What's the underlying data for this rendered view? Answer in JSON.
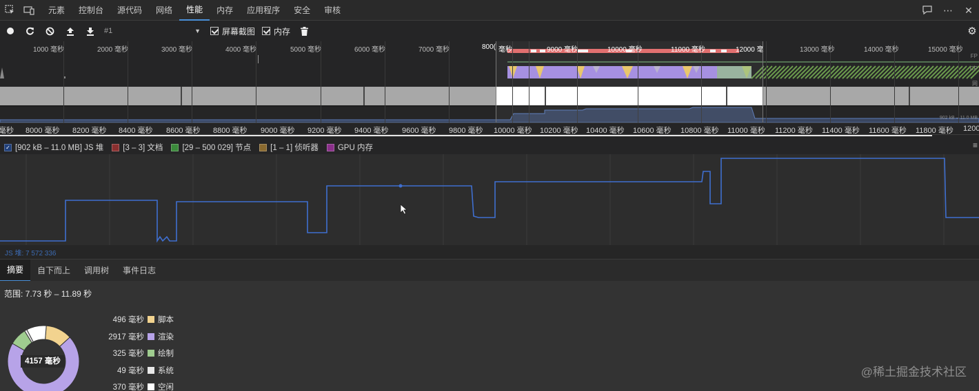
{
  "tabbar": {
    "tabs": [
      "元素",
      "控制台",
      "源代码",
      "网络",
      "性能",
      "内存",
      "应用程序",
      "安全",
      "审核"
    ],
    "active_index": 4
  },
  "toolbar": {
    "profile_label": "#1",
    "screenshots_label": "屏幕截图",
    "memory_label": "内存"
  },
  "overview": {
    "ticks": [
      "1000 毫秒",
      "2000 毫秒",
      "3000 毫秒",
      "4000 毫秒",
      "5000 毫秒",
      "6000 毫秒",
      "7000 毫秒",
      "800(",
      "毫秒",
      "9000 毫秒",
      "10000 毫秒",
      "11000 毫秒",
      "12000 毫",
      "13000 毫秒",
      "14000 毫秒",
      "15000 毫秒"
    ],
    "labels": [
      "FP",
      "CP",
      "网",
      "902 kB – 11.0 MB"
    ]
  },
  "ruler": {
    "ticks": [
      "毫秒",
      "8000 毫秒",
      "8200 毫秒",
      "8400 毫秒",
      "8600 毫秒",
      "8800 毫秒",
      "9000 毫秒",
      "9200 毫秒",
      "9400 毫秒",
      "9600 毫秒",
      "9800 毫秒",
      "10000 毫秒",
      "10200 毫秒",
      "10400 毫秒",
      "10600 毫秒",
      "10800 毫秒",
      "11000 毫秒",
      "11200 毫秒",
      "11400 毫秒",
      "11600 毫秒",
      "11800 毫秒",
      "1200"
    ]
  },
  "legend": {
    "items": [
      {
        "label": "[902 kB – 11.0 MB] JS 堆",
        "color": "#3f6fb5",
        "checked": true
      },
      {
        "label": "[3 – 3] 文档",
        "color": "#8a2f2f",
        "checked": true
      },
      {
        "label": "[29 – 500 029] 节点",
        "color": "#3b8a3b",
        "checked": true
      },
      {
        "label": "[1 – 1] 侦听器",
        "color": "#8a6a2f",
        "checked": true
      },
      {
        "label": "GPU 内存",
        "color": "#8a2f8a",
        "checked": false
      }
    ]
  },
  "memgraph": {
    "label": "JS 堆: 7 572 336"
  },
  "bottom_tabs": {
    "tabs": [
      "摘要",
      "自下而上",
      "调用树",
      "事件日志"
    ],
    "active_index": 0
  },
  "summary": {
    "range": "范围: 7.73 秒 – 11.89 秒",
    "total": "4157 毫秒",
    "rows": [
      {
        "value": "496 毫秒",
        "label": "脚本",
        "color": "#f2d38f",
        "ms": 496
      },
      {
        "value": "2917 毫秒",
        "label": "渲染",
        "color": "#b7a3e8",
        "ms": 2917
      },
      {
        "value": "325 毫秒",
        "label": "绘制",
        "color": "#9fcc8f",
        "ms": 325
      },
      {
        "value": "49 毫秒",
        "label": "系统",
        "color": "#e8e8e8",
        "ms": 49
      },
      {
        "value": "370 毫秒",
        "label": "空闲",
        "color": "#ffffff",
        "ms": 370
      }
    ]
  },
  "watermark": "@稀土掘金技术社区"
}
